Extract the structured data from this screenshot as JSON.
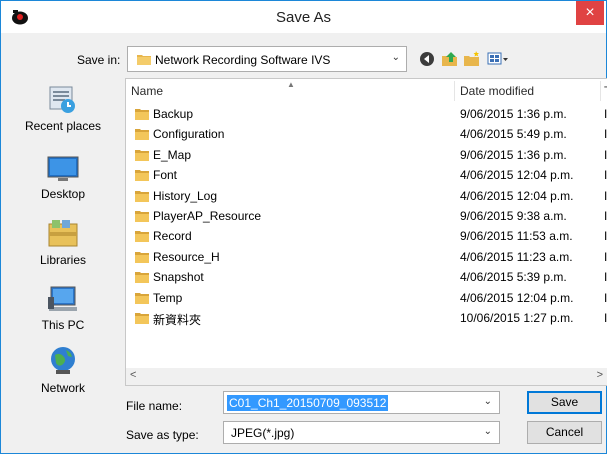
{
  "window": {
    "title": "Save As",
    "close_glyph": "×"
  },
  "toolbar": {
    "save_in_label": "Save in:",
    "save_in_value": "Network Recording Software IVS",
    "icons": [
      "back-icon",
      "up-folder-icon",
      "new-folder-icon",
      "views-menu-icon"
    ]
  },
  "places": [
    {
      "label": "Recent places",
      "icon": "recent-places-icon"
    },
    {
      "label": "Desktop",
      "icon": "desktop-icon"
    },
    {
      "label": "Libraries",
      "icon": "libraries-icon"
    },
    {
      "label": "This PC",
      "icon": "this-pc-icon"
    },
    {
      "label": "Network",
      "icon": "network-icon"
    }
  ],
  "filelist": {
    "columns": {
      "name": "Name",
      "date": "Date modified",
      "type": "T"
    },
    "rows": [
      {
        "name": "Backup",
        "date": "9/06/2015 1:36 p.m.",
        "trunc": "I"
      },
      {
        "name": "Configuration",
        "date": "4/06/2015 5:49 p.m.",
        "trunc": "I"
      },
      {
        "name": "E_Map",
        "date": "9/06/2015 1:36 p.m.",
        "trunc": "I"
      },
      {
        "name": "Font",
        "date": "4/06/2015 12:04 p.m.",
        "trunc": "I"
      },
      {
        "name": "History_Log",
        "date": "4/06/2015 12:04 p.m.",
        "trunc": "I"
      },
      {
        "name": "PlayerAP_Resource",
        "date": "9/06/2015 9:38 a.m.",
        "trunc": "I"
      },
      {
        "name": "Record",
        "date": "9/06/2015 11:53 a.m.",
        "trunc": "I"
      },
      {
        "name": "Resource_H",
        "date": "4/06/2015 11:23 a.m.",
        "trunc": "I"
      },
      {
        "name": "Snapshot",
        "date": "4/06/2015 5:39 p.m.",
        "trunc": "I"
      },
      {
        "name": "Temp",
        "date": "4/06/2015 12:04 p.m.",
        "trunc": "I"
      },
      {
        "name": "新資料夾",
        "date": "10/06/2015 1:27 p.m.",
        "trunc": "I"
      }
    ],
    "scroll_left": "<",
    "scroll_right": ">"
  },
  "form": {
    "file_name_label": "File name:",
    "file_name_value": "C01_Ch1_20150709_093512",
    "save_as_type_label": "Save as type:",
    "save_as_type_value": "JPEG(*.jpg)"
  },
  "buttons": {
    "save": "Save",
    "cancel": "Cancel"
  },
  "colors": {
    "accent": "#0078d7",
    "selection": "#3399ff",
    "close": "#e04343",
    "folder": "#e8b64c"
  }
}
